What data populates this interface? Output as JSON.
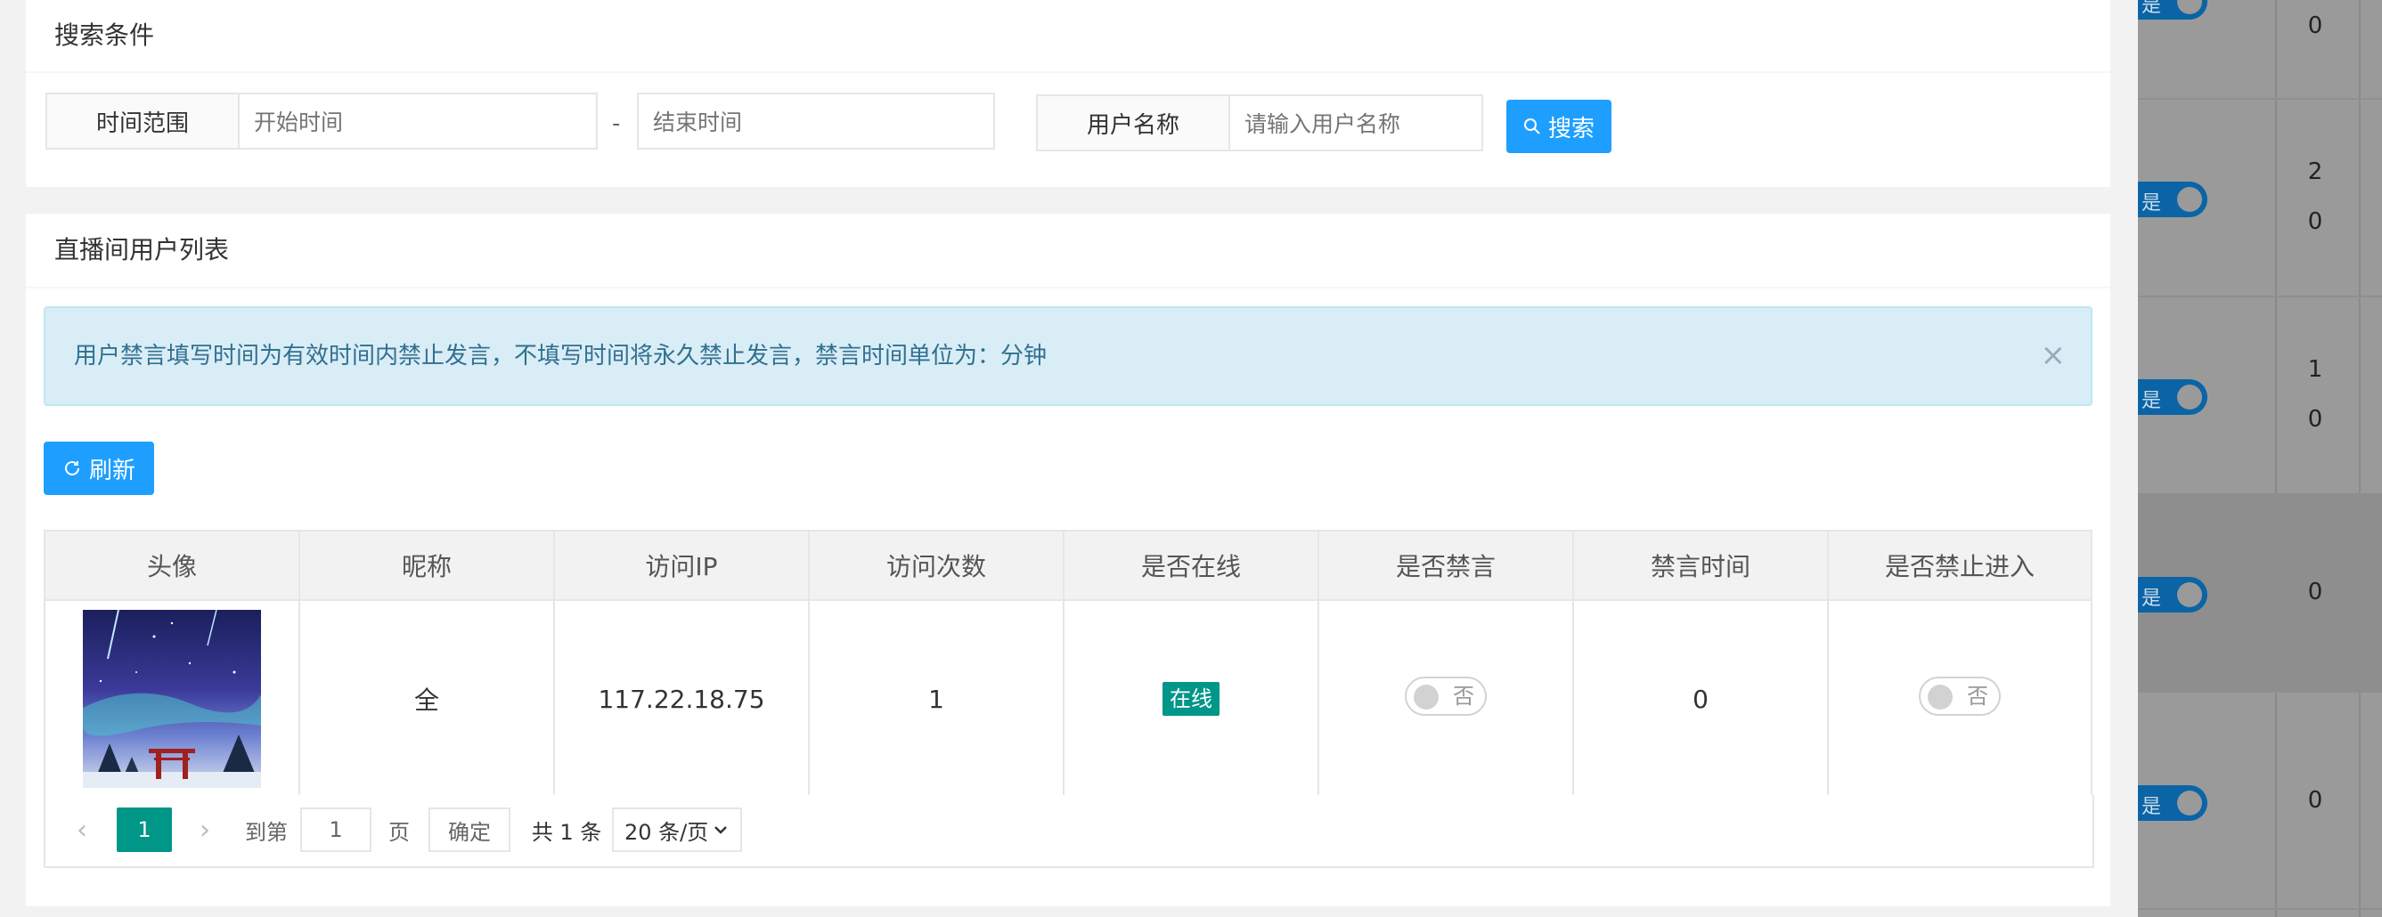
{
  "search": {
    "title": "搜索条件",
    "time_range_label": "时间范围",
    "start_placeholder": "开始时间",
    "separator": "-",
    "end_placeholder": "结束时间",
    "username_label": "用户名称",
    "username_placeholder": "请输入用户名称",
    "search_button": "搜索"
  },
  "list": {
    "title": "直播间用户列表",
    "alert_text": "用户禁言填写时间为有效时间内禁止发言，不填写时间将永久禁止发言，禁言时间单位为：分钟",
    "alert_close": "×",
    "refresh_button": "刷新",
    "columns": [
      "头像",
      "昵称",
      "访问IP",
      "访问次数",
      "是否在线",
      "是否禁言",
      "禁言时间",
      "是否禁止进入"
    ],
    "rows": [
      {
        "nickname": "全",
        "ip": "117.22.18.75",
        "visits": "1",
        "online": "在线",
        "muted": "否",
        "mute_time": "0",
        "banned": "否"
      }
    ]
  },
  "pager": {
    "current_page": "1",
    "goto_label": "到第",
    "goto_value": "1",
    "page_suffix": "页",
    "confirm": "确定",
    "total": "共 1 条",
    "page_size": "20 条/页"
  },
  "background_page": {
    "toggle_label": "是",
    "rows": [
      {
        "value": "0"
      },
      {
        "value_line1": "2",
        "value_line2": "0"
      },
      {
        "value_line1": "1",
        "value_line2": "0"
      },
      {
        "value": "0"
      },
      {
        "value": "0"
      }
    ]
  },
  "colors": {
    "primary_blue": "#1e9fff",
    "accent_green": "#009688",
    "alert_bg": "#d9edf7",
    "alert_text": "#31708f"
  }
}
